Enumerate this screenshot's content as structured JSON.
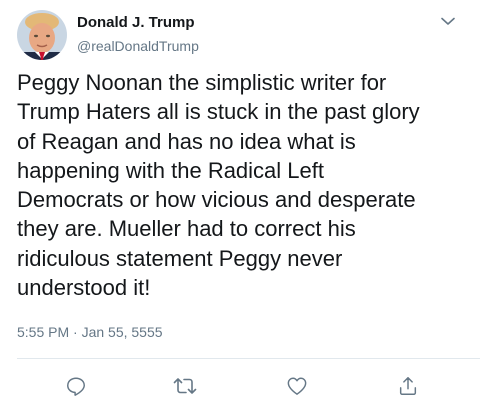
{
  "tweet": {
    "author": {
      "display_name": "Donald J. Trump",
      "handle": "@realDonaldTrump"
    },
    "text": "Peggy Noonan the simplistic writer for\nTrump Haters all is stuck in the past glory\nof Reagan and has no idea what is\nhappening with the Radical Left\nDemocrats or how vicious and desperate\nthey are. Mueller had to correct his\nridiculous statement Peggy never\nunderstood it!",
    "timestamp": "5:55 PM · Jan 55, 5555"
  },
  "icons": {
    "menu": "chevron-down-icon",
    "reply": "reply-icon",
    "retweet": "retweet-icon",
    "like": "heart-icon",
    "share": "share-icon"
  },
  "colors": {
    "text_primary": "#14171a",
    "text_secondary": "#657786",
    "icon": "#657786",
    "divider": "#e1e8ed"
  }
}
